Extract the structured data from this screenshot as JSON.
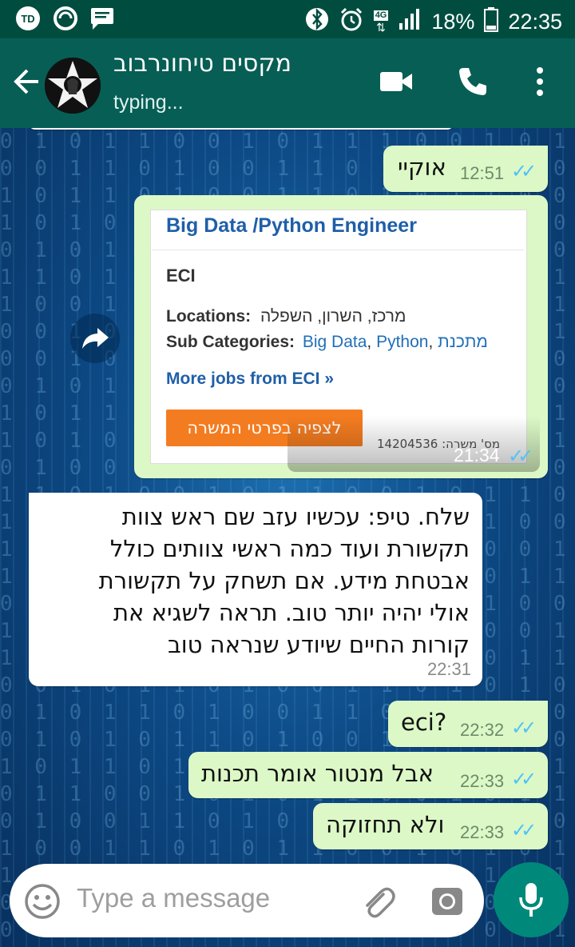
{
  "status_bar": {
    "battery": "18%",
    "time": "22:35",
    "network": "4G"
  },
  "header": {
    "contact_name": "מקסים טיחונרבוב",
    "status": "typing..."
  },
  "messages": [
    {
      "text": "אוקיי",
      "time": "12:51"
    },
    {
      "time": "21:34"
    },
    {
      "lines": [
        "שלח. טיפ: עכשיו עזב שם ראש צוות",
        "תקשורת ועוד כמה ראשי צוותים כולל",
        "אבטחת מידע. אם תשחק על תקשורת",
        "אולי יהיה יותר טוב. תראה לשגיא את",
        "קורות החיים שיודע שנראה טוב"
      ],
      "time": "22:31"
    },
    {
      "text": "eci?",
      "time": "22:32"
    },
    {
      "text": "אבל מנטור אומר תכנות",
      "time": "22:33"
    },
    {
      "text": "ולא תחזוקה",
      "time": "22:33"
    }
  ],
  "job_card": {
    "title": "Big Data /Python Engineer",
    "company": "ECI",
    "locations_label": "Locations:",
    "locations_value": "מרכז, השרון, השפלה",
    "subcat_label": "Sub Categories:",
    "subcat_1": "Big Data",
    "subcat_2": "Python",
    "subcat_3": "מתכנת",
    "more_link": "More jobs from ECI »",
    "button_label": "לצפיה בפרטי המשרה",
    "job_id": "מס' משרה: 14204536"
  },
  "input": {
    "placeholder": "Type a message"
  },
  "colors": {
    "header": "#075e54",
    "outgoing": "#dcf8c6",
    "accent": "#00897b",
    "read_ticks": "#4fc3f7"
  }
}
